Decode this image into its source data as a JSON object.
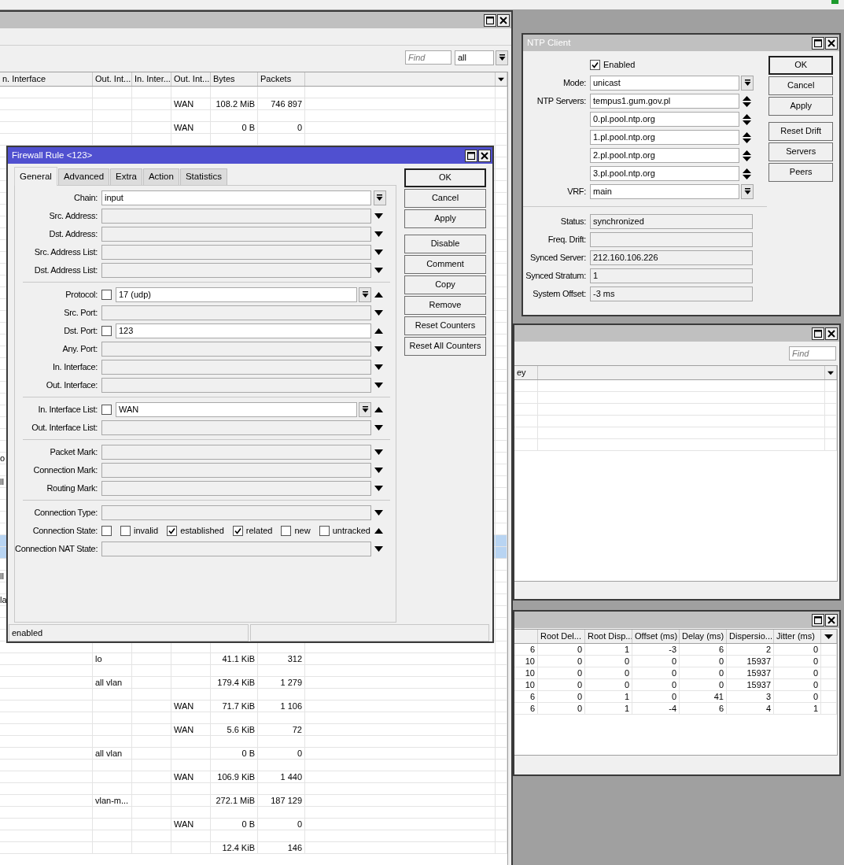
{
  "main_window": {
    "find_placeholder": "Find",
    "filter_value": "all",
    "columns": [
      "n. Interface",
      "Out. Int...",
      "In. Inter...",
      "Out. Int...",
      "Bytes",
      "Packets"
    ],
    "rows": [
      {
        "selected": false
      },
      {
        "selected": false,
        "column_4": "WAN",
        "column_5": "108.2 MiB",
        "column_6": "746 897"
      },
      {
        "selected": false
      },
      {
        "selected": false,
        "column_4": "WAN",
        "column_5": "0 B",
        "column_6": "0"
      },
      {
        "selected": false
      },
      {
        "selected": false
      },
      {
        "selected": false
      },
      {
        "selected": false
      },
      {
        "selected": false
      },
      {
        "selected": false
      },
      {
        "selected": false
      },
      {
        "selected": false
      },
      {
        "selected": false
      },
      {
        "selected": false
      },
      {
        "selected": false
      },
      {
        "selected": false
      },
      {
        "selected": false
      },
      {
        "selected": false
      },
      {
        "selected": false
      },
      {
        "selected": false
      },
      {
        "selected": false
      },
      {
        "selected": false
      },
      {
        "selected": false
      },
      {
        "selected": false
      },
      {
        "selected": false
      },
      {
        "selected": false
      },
      {
        "selected": false
      },
      {
        "selected": false
      },
      {
        "selected": false
      },
      {
        "selected": false
      },
      {
        "selected": false
      },
      {
        "selected": false,
        "column_1": "o"
      },
      {
        "selected": false
      },
      {
        "selected": false,
        "column_1": "ll"
      },
      {
        "selected": false
      },
      {
        "selected": false
      },
      {
        "selected": false
      },
      {
        "selected": false
      },
      {
        "selected": true
      },
      {
        "selected": true
      },
      {
        "selected": false
      },
      {
        "selected": false,
        "column_1": "ll"
      },
      {
        "selected": false
      },
      {
        "selected": false,
        "column_1": "la"
      },
      {
        "selected": false
      },
      {
        "selected": false
      },
      {
        "selected": false
      },
      {
        "selected": false
      },
      {
        "selected": false,
        "column_2": "lo",
        "column_5": "41.1 KiB",
        "column_6": "312"
      },
      {
        "selected": false
      },
      {
        "selected": false,
        "column_2": "all vlan",
        "column_5": "179.4 KiB",
        "column_6": "1 279"
      },
      {
        "selected": false
      },
      {
        "selected": false,
        "column_4": "WAN",
        "column_5": "71.7 KiB",
        "column_6": "1 106"
      },
      {
        "selected": false
      },
      {
        "selected": false,
        "column_4": "WAN",
        "column_5": "5.6 KiB",
        "column_6": "72"
      },
      {
        "selected": false
      },
      {
        "selected": false,
        "column_2": "all vlan",
        "column_5": "0 B",
        "column_6": "0"
      },
      {
        "selected": false
      },
      {
        "selected": false,
        "column_4": "WAN",
        "column_5": "106.9 KiB",
        "column_6": "1 440"
      },
      {
        "selected": false
      },
      {
        "selected": false,
        "column_2": "vlan-m...",
        "column_5": "272.1 MiB",
        "column_6": "187 129"
      },
      {
        "selected": false
      },
      {
        "selected": false,
        "column_4": "WAN",
        "column_5": "0 B",
        "column_6": "0"
      },
      {
        "selected": false
      },
      {
        "selected": false,
        "column_5": "12.4 KiB",
        "column_6": "146"
      }
    ]
  },
  "ntp_client": {
    "title": "NTP Client",
    "enabled": {
      "label": "Enabled",
      "checked": true
    },
    "fields": [
      {
        "label": "Mode:",
        "value": "unicast",
        "kind": "select"
      },
      {
        "label": "NTP Servers:",
        "value": "tempus1.gum.gov.pl",
        "kind": "list"
      },
      {
        "value": "0.pl.pool.ntp.org",
        "kind": "list"
      },
      {
        "value": "1.pl.pool.ntp.org",
        "kind": "list"
      },
      {
        "value": "2.pl.pool.ntp.org",
        "kind": "list"
      },
      {
        "value": "3.pl.pool.ntp.org",
        "kind": "list"
      },
      {
        "label": "VRF:",
        "value": "main",
        "kind": "select"
      }
    ],
    "status": [
      {
        "label": "Status:",
        "value": "synchronized"
      },
      {
        "label": "Freq. Drift:"
      },
      {
        "label": "Synced Server:",
        "value": "212.160.106.226"
      },
      {
        "label": "Synced Stratum:",
        "value": "1"
      },
      {
        "label": "System Offset:",
        "value": "-3 ms"
      }
    ],
    "buttons": [
      [
        {
          "label": "OK",
          "default": true
        },
        {
          "label": "Cancel",
          "default": false
        },
        {
          "label": "Apply",
          "default": false
        }
      ],
      [
        {
          "label": "Reset Drift",
          "default": false
        },
        {
          "label": "Servers",
          "default": false
        },
        {
          "label": "Peers",
          "default": false
        }
      ]
    ]
  },
  "middle_window": {
    "find_placeholder": "Find",
    "columns": [
      "ey"
    ],
    "rows": [
      {
        "selected": false
      },
      {
        "selected": false
      },
      {
        "selected": false
      },
      {
        "selected": false
      },
      {
        "selected": false
      },
      {
        "selected": false
      }
    ]
  },
  "bottom_window": {
    "columns": [
      "Root Del...",
      "Root Disp...",
      "Offset (ms)",
      "Delay (ms)",
      "Dispersio...",
      "Jitter (ms)"
    ],
    "rows": [
      {
        "selected": false,
        "values": [
          "6",
          "0",
          "1",
          "-3",
          "6",
          "2",
          "0"
        ]
      },
      {
        "selected": false,
        "values": [
          "10",
          "0",
          "0",
          "0",
          "0",
          "15937",
          "0"
        ]
      },
      {
        "selected": false,
        "values": [
          "10",
          "0",
          "0",
          "0",
          "0",
          "15937",
          "0"
        ]
      },
      {
        "selected": false,
        "values": [
          "10",
          "0",
          "0",
          "0",
          "0",
          "15937",
          "0"
        ]
      },
      {
        "selected": false,
        "values": [
          "6",
          "0",
          "1",
          "0",
          "41",
          "3",
          "0"
        ]
      },
      {
        "selected": false,
        "values": [
          "6",
          "0",
          "1",
          "-4",
          "6",
          "4",
          "1"
        ]
      }
    ]
  },
  "firewall_rule": {
    "title": "Firewall Rule <123>",
    "tabs": [
      {
        "label": "General",
        "selected": true
      },
      {
        "label": "Advanced",
        "selected": false
      },
      {
        "label": "Extra",
        "selected": false
      },
      {
        "label": "Action",
        "selected": false
      },
      {
        "label": "Statistics",
        "selected": false
      }
    ],
    "sections": [
      [
        {
          "label": "Chain:",
          "kind": "select",
          "value": "input"
        },
        {
          "label": "Src. Address:",
          "kind": "unset",
          "expanded": false
        },
        {
          "label": "Dst. Address:",
          "kind": "unset",
          "expanded": false
        },
        {
          "label": "Src. Address List:",
          "kind": "unset",
          "expanded": false
        },
        {
          "label": "Dst. Address List:",
          "kind": "unset",
          "expanded": false
        }
      ],
      [
        {
          "label": "Protocol:",
          "kind": "negatable_select",
          "inverted": false,
          "value": "17 (udp)",
          "expanded": true
        },
        {
          "label": "Src. Port:",
          "kind": "unset",
          "expanded": false
        },
        {
          "label": "Dst. Port:",
          "kind": "negatable_text",
          "inverted": false,
          "value": "123",
          "expanded": true
        },
        {
          "label": "Any. Port:",
          "kind": "unset",
          "expanded": false
        },
        {
          "label": "In. Interface:",
          "kind": "unset",
          "expanded": false
        },
        {
          "label": "Out. Interface:",
          "kind": "unset",
          "expanded": false
        }
      ],
      [
        {
          "label": "In. Interface List:",
          "kind": "negatable_select",
          "inverted": false,
          "value": "WAN",
          "expanded": true
        },
        {
          "label": "Out. Interface List:",
          "kind": "unset",
          "expanded": false
        }
      ],
      [
        {
          "label": "Packet Mark:",
          "kind": "unset",
          "expanded": false
        },
        {
          "label": "Connection Mark:",
          "kind": "unset",
          "expanded": false
        },
        {
          "label": "Routing Mark:",
          "kind": "unset",
          "expanded": false
        }
      ],
      [
        {
          "label": "Connection Type:",
          "kind": "unset",
          "expanded": false
        },
        {
          "label": "Connection State:",
          "kind": "states",
          "inverted": false,
          "expanded": true,
          "options": [
            {
              "label": "invalid",
              "checked": false
            },
            {
              "label": "established",
              "checked": true
            },
            {
              "label": "related",
              "checked": true
            },
            {
              "label": "new",
              "checked": false
            },
            {
              "label": "untracked",
              "checked": false
            }
          ]
        },
        {
          "label": "Connection NAT State:",
          "kind": "unset",
          "expanded": false
        }
      ]
    ],
    "buttons": [
      [
        {
          "label": "OK",
          "default": true
        },
        {
          "label": "Cancel",
          "default": false
        },
        {
          "label": "Apply",
          "default": false
        }
      ],
      [
        {
          "label": "Disable",
          "default": false
        },
        {
          "label": "Comment",
          "default": false
        },
        {
          "label": "Copy",
          "default": false
        },
        {
          "label": "Remove",
          "default": false
        },
        {
          "label": "Reset Counters",
          "default": false
        },
        {
          "label": "Reset All Counters",
          "default": false
        }
      ]
    ],
    "status_bar": {
      "text": "enabled"
    }
  }
}
